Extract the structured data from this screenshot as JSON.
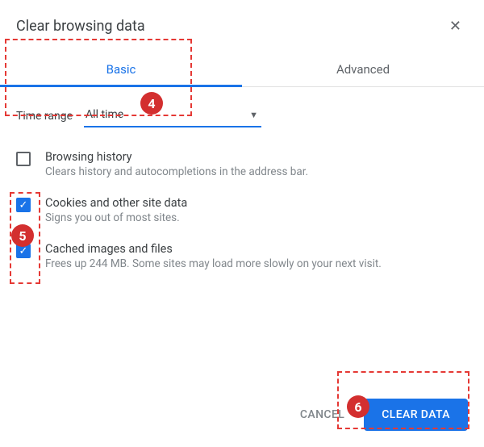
{
  "dialog": {
    "title": "Clear browsing data"
  },
  "tabs": {
    "basic": "Basic",
    "advanced": "Advanced"
  },
  "time_range": {
    "label": "Time range",
    "value": "All time"
  },
  "options": [
    {
      "title": "Browsing history",
      "desc": "Clears history and autocompletions in the address bar.",
      "checked": false
    },
    {
      "title": "Cookies and other site data",
      "desc": "Signs you out of most sites.",
      "checked": true
    },
    {
      "title": "Cached images and files",
      "desc": "Frees up 244 MB. Some sites may load more slowly on your next visit.",
      "checked": true
    }
  ],
  "buttons": {
    "cancel": "CANCEL",
    "clear": "CLEAR DATA"
  },
  "annotations": {
    "step4": "4",
    "step5": "5",
    "step6": "6"
  }
}
